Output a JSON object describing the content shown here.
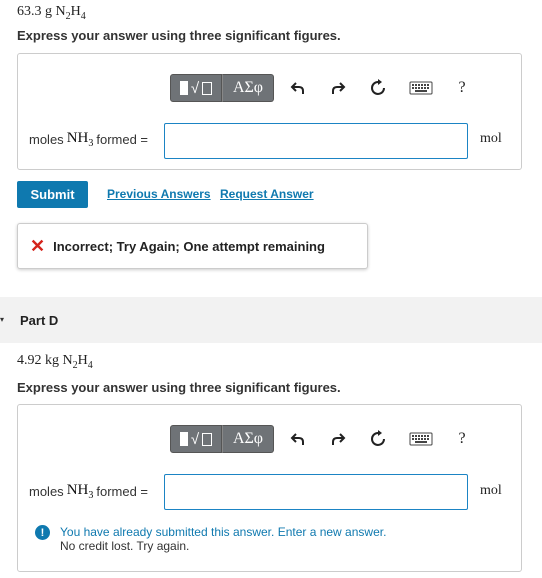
{
  "partC": {
    "problem": {
      "amount": "63.3",
      "unit": "g",
      "formula": {
        "n": "N",
        "n_sub": "2",
        "h": "H",
        "h_sub": "4"
      }
    },
    "instruction": "Express your answer using three significant figures.",
    "label": {
      "pre": "moles",
      "nh": "NH",
      "nh_sub": "3",
      "post": "formed ="
    },
    "input_value": "",
    "unit": "mol",
    "submit_label": "Submit",
    "previous_answers": "Previous Answers",
    "request_answer": "Request Answer",
    "feedback": "Incorrect; Try Again; One attempt remaining"
  },
  "toolbar": {
    "greek": "ΑΣφ",
    "help": "?",
    "icons": [
      "templates-icon",
      "greek-letters-icon",
      "undo-icon",
      "redo-icon",
      "reset-icon",
      "keyboard-icon",
      "help-icon"
    ]
  },
  "partD": {
    "title": "Part D",
    "problem": {
      "amount": "4.92",
      "unit": "kg",
      "formula": {
        "n": "N",
        "n_sub": "2",
        "h": "H",
        "h_sub": "4"
      }
    },
    "instruction": "Express your answer using three significant figures.",
    "label": {
      "pre": "moles",
      "nh": "NH",
      "nh_sub": "3",
      "post": "formed ="
    },
    "input_value": "",
    "unit": "mol",
    "info_line1": "You have already submitted this answer. Enter a new answer.",
    "info_line2": "No credit lost. Try again."
  },
  "colors": {
    "accent": "#0f79af",
    "error": "#d4231b",
    "toolbar": "#6f7377"
  }
}
